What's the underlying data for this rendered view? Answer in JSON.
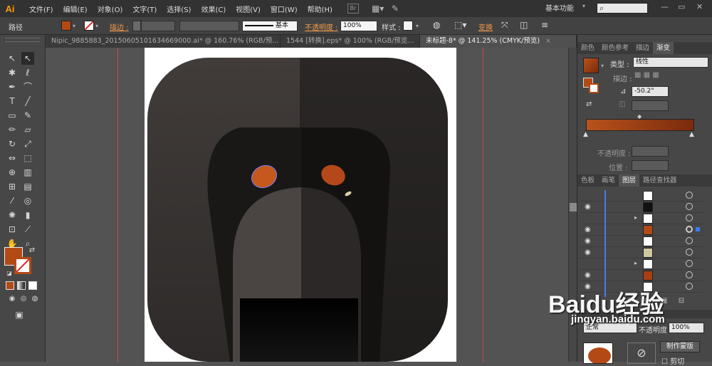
{
  "menubar": {
    "logo": "Ai",
    "items": [
      "文件(F)",
      "编辑(E)",
      "对象(O)",
      "文字(T)",
      "选择(S)",
      "效果(C)",
      "视图(V)",
      "窗口(W)",
      "帮助(H)"
    ],
    "workspace": "基本功能",
    "search_icon": "search-icon"
  },
  "control_bar": {
    "selection_label": "路径",
    "stroke_label": "描边 :",
    "stroke_style": "基本",
    "opacity_label": "不透明度 :",
    "opacity_value": "100%",
    "style_label": "样式 :",
    "transform_label": "变换"
  },
  "doc_tabs": [
    {
      "title": "Nipic_9885883_20150605101634669000.ai* @ 160.76% (RGB/预...",
      "close": "×"
    },
    {
      "title": "1544 [转换].eps* @ 100% (RGB/预览...",
      "close": "×"
    },
    {
      "title": "未标题-8* @ 141.25% (CMYK/预览)",
      "close": "×"
    }
  ],
  "panels": {
    "top_tabs": [
      "颜色",
      "颜色参考",
      "描边",
      "渐变"
    ],
    "gradient": {
      "type_label": "类型 :",
      "type_value": "线性",
      "stroke_label": "描边 :",
      "angle_value": "-50.2°",
      "opacity_label": "不透明度 :",
      "location_label": "位置 :"
    },
    "mid_tabs": [
      "色板",
      "画笔",
      "图层",
      "路径查找器"
    ],
    "bottom": {
      "blend_mode": "正常",
      "opacity_label": "不透明度 :",
      "opacity_value": "100%",
      "mask_button": "制作蒙版",
      "clip_label": "剪切"
    }
  },
  "watermark": {
    "brand": "Baidu经验",
    "url": "jingyan.baidu.com"
  },
  "colors": {
    "accent_orange": "#f09a4a",
    "fill": "#b34a15",
    "gradient_start": "#b8521c",
    "gradient_end": "#7a2a0c",
    "layer_selection": "#3a7bff"
  }
}
